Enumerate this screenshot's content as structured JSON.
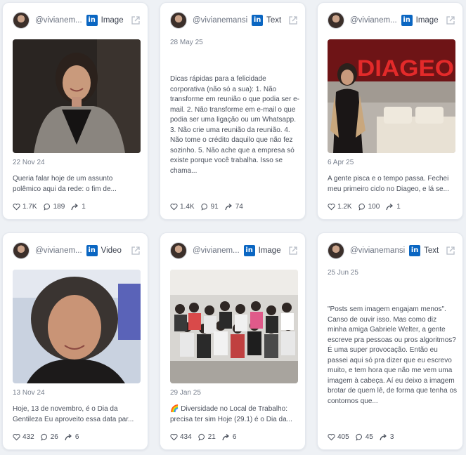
{
  "cards": [
    {
      "handle": "@vivianem...",
      "type": "Image",
      "date": "22 Nov 24",
      "text": "Queria falar hoje de um assunto polêmico aqui da rede: o fim de...",
      "likes": "1.7K",
      "comments": "189",
      "shares": "1",
      "media": "portrait-woman-gray-scarf"
    },
    {
      "handle": "@vivianemansi",
      "type": "Text",
      "date": "28 May 25",
      "text": "Dicas rápidas para a felicidade corporativa (não só a sua): 1. Não transforme em reunião o que podia ser e-mail. 2. Não transforme em e-mail o que podia ser uma ligação ou um Whatsapp. 3. Não crie uma reunião da reunião. 4. Não tome o crédito daquilo que não fez sozinho. 5. Não ache que a empresa só existe porque você trabalha. Isso se chama...",
      "likes": "1.4K",
      "comments": "91",
      "shares": "74"
    },
    {
      "handle": "@vivianem...",
      "type": "Image",
      "date": "6 Apr 25",
      "text": "A gente pisca e o tempo passa. Fechei meu primeiro ciclo no Diageo, e lá se...",
      "likes": "1.2K",
      "comments": "100",
      "shares": "1",
      "media": "diageo-office",
      "media_text": "DIAGEO"
    },
    {
      "handle": "@vivianem...",
      "type": "Video",
      "date": "13 Nov 24",
      "text": "Hoje, 13 de novembro, é o Dia da Gentileza Eu aproveito essa data par...",
      "likes": "432",
      "comments": "26",
      "shares": "6",
      "media": "selfie-woman-curly-hair"
    },
    {
      "handle": "@vivianem...",
      "type": "Image",
      "date": "29 Jan 25",
      "text": "🌈 Diversidade no Local de Trabalho: precisa ter sim Hoje (29.1) é o Dia da...",
      "likes": "434",
      "comments": "21",
      "shares": "6",
      "media": "group-photo"
    },
    {
      "handle": "@vivianemansi",
      "type": "Text",
      "date": "25 Jun 25",
      "text": "\"Posts sem imagem engajam menos\". Canso de ouvir isso. Mas como diz minha amiga Gabriele Welter, a gente escreve pra pessoas ou pros algoritmos? É uma super provocação. Então eu passei aqui só pra dizer que eu escrevo muito, e tem hora que não me vem uma imagem à cabeça. Aí eu deixo a imagem brotar de quem lê, de forma que tenha os contornos que...",
      "likes": "405",
      "comments": "45",
      "shares": "3"
    }
  ]
}
